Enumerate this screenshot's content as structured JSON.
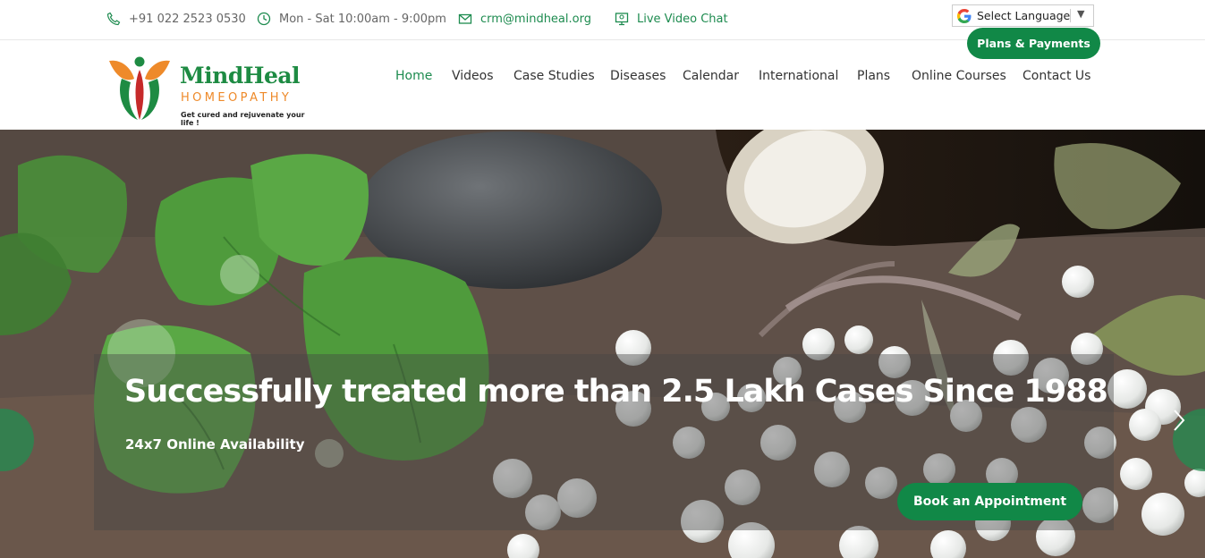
{
  "topbar": {
    "phone": "+91 022 2523 0530",
    "hours": "Mon - Sat 10:00am - 9:00pm",
    "email": "crm@mindheal.org",
    "video_chat": "Live Video Chat",
    "language_select": "Select Language",
    "plans_button": "Plans & Payments"
  },
  "logo": {
    "title": "MindHeal",
    "subtitle": "HOMEOPATHY",
    "tagline": "Get cured and rejuvenate your life !"
  },
  "nav": {
    "items": [
      "Home",
      "Videos",
      "Case Studies",
      "Diseases",
      "Calendar",
      "International",
      "Plans",
      "Online Courses",
      "Contact Us"
    ],
    "active": "Home"
  },
  "hero": {
    "headline": "Successfully treated more than 2.5 Lakh Cases Since 1988",
    "subline": "24x7 Online Availability",
    "cta": "Book an Appointment"
  },
  "icons": {
    "phone": "phone-icon",
    "clock": "clock-icon",
    "email": "envelope-icon",
    "video": "video-chat-icon",
    "google": "google-icon",
    "prev": "chevron-left-icon",
    "next": "chevron-right-icon"
  },
  "colors": {
    "brand_green": "#118847",
    "logo_orange": "#ee8a2a"
  }
}
